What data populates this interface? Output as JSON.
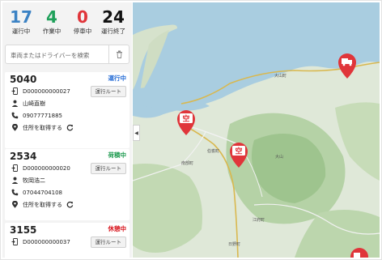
{
  "stats": [
    {
      "value": "17",
      "label": "運行中",
      "color": "#3b82c4"
    },
    {
      "value": "4",
      "label": "作業中",
      "color": "#1fa05a"
    },
    {
      "value": "0",
      "label": "停車中",
      "color": "#e0353a"
    },
    {
      "value": "24",
      "label": "運行終了",
      "color": "#111111"
    }
  ],
  "search": {
    "placeholder": "車両またはドライバーを検索"
  },
  "vehicles": [
    {
      "number": "5040",
      "status": "運行中",
      "status_color": "#2a6fd6",
      "device": "D000000000027",
      "route_label": "運行ルート",
      "driver": "山崎直樹",
      "phone": "09077771885",
      "address_label": "住所を取得する"
    },
    {
      "number": "2534",
      "status": "荷積中",
      "status_color": "#1d9a4f",
      "device": "D000000000020",
      "route_label": "運行ルート",
      "driver": "牧岡浩二",
      "phone": "07044704108",
      "address_label": "住所を取得する"
    },
    {
      "number": "3155",
      "status": "休憩中",
      "status_color": "#d8141c",
      "device": "D000000000037",
      "route_label": "運行ルート"
    }
  ],
  "map": {
    "markers": [
      {
        "label": "空",
        "color": "#e0353a",
        "kind": "empty-truck"
      },
      {
        "label": "空",
        "color": "#e0353a",
        "kind": "empty-truck"
      },
      {
        "label": "",
        "color": "#e0353a",
        "kind": "truck"
      },
      {
        "label": "",
        "color": "#e0353a",
        "kind": "truck"
      }
    ],
    "place_labels": [
      "南部町",
      "伯耆町",
      "大山",
      "日野町",
      "江府町",
      "大山町"
    ],
    "collapse_icon": "chevron-left-icon"
  }
}
